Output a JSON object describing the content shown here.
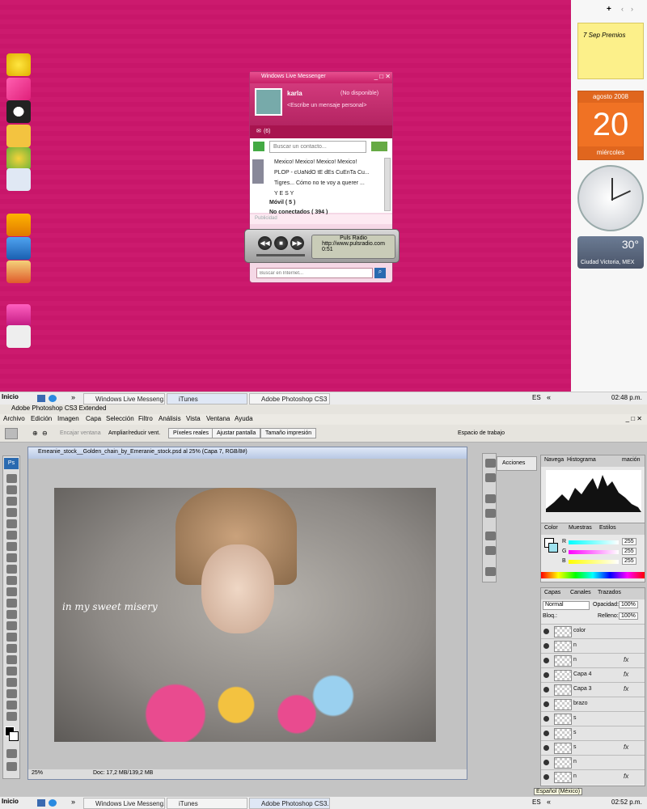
{
  "messenger": {
    "title": "Windows Live Messenger",
    "user_name": "karla",
    "status": "(No disponible)",
    "personal_msg": "<Escribe un mensaje personal>",
    "mail_count": "(6)",
    "search_placeholder": "Buscar un contacto...",
    "contacts": [
      "Mexico! Mexico! Mexico! Mexico!",
      "PLOP - cUaNdO tE dEs CuEnTa Cu...",
      "Tigres... Cómo no te voy a querer ...",
      "Y E S Y"
    ],
    "groups": [
      "Móvil ( 5 )",
      "No conectados ( 394 )"
    ],
    "ad_label": "Publicidad",
    "web_search_placeholder": "Buscar en Internet..."
  },
  "puls_radio": {
    "name": "Puls Radio",
    "url": "http://www.pulsradio.com",
    "time": "0:51"
  },
  "gadgets": {
    "note": "7 Sep Premios",
    "calendar_month": "agosto 2008",
    "calendar_day": "20",
    "calendar_weekday": "miércoles",
    "weather_temp": "30°",
    "weather_city": "Ciudad Victoria, MEX",
    "sidebar_controls": [
      "+",
      "‹",
      "›"
    ]
  },
  "taskbar_top": {
    "start": "Inicio",
    "items": [
      "Windows Live Messeng...",
      "iTunes",
      "Adobe Photoshop CS3 ..."
    ],
    "lang": "ES",
    "clock": "02:48 p.m."
  },
  "photoshop": {
    "title": "Adobe Photoshop CS3 Extended",
    "menu": [
      "Archivo",
      "Edición",
      "Imagen",
      "Capa",
      "Selección",
      "Filtro",
      "Análisis",
      "Vista",
      "Ventana",
      "Ayuda"
    ],
    "options": {
      "fit_window": "Encajar ventana",
      "resize": "Ampliar/reducir vent.",
      "actual_pixels": "Píxeles reales",
      "fit_screen": "Ajustar pantalla",
      "print_size": "Tamaño impresión",
      "workspace": "Espacio de trabajo"
    },
    "doc_title": "Emeanie_stock__Golden_chain_by_Emeranie_stock.psd al 25% (Capa 7, RGB/8#)",
    "zoom": "25%",
    "doc_info": "Doc: 17,2 MB/139,2 MB",
    "artwork_text": "in my sweet misery",
    "panels": {
      "actions_label": "Acciones",
      "nav_tabs": [
        "Navega",
        "Histograma",
        "mación"
      ],
      "color_tabs": [
        "Color",
        "Muestras",
        "Estilos"
      ],
      "color_values": [
        {
          "ch": "R",
          "val": "255"
        },
        {
          "ch": "G",
          "val": "255"
        },
        {
          "ch": "B",
          "val": "255"
        }
      ],
      "layer_tabs": [
        "Capas",
        "Canales",
        "Trazados"
      ],
      "blend_mode": "Normal",
      "opacity_label": "Opacidad:",
      "opacity": "100%",
      "lock_label": "Bloq.:",
      "fill_label": "Relleno:",
      "fill": "100%",
      "layers": [
        {
          "name": "color",
          "fx": ""
        },
        {
          "name": "n",
          "fx": ""
        },
        {
          "name": "n",
          "fx": "fx"
        },
        {
          "name": "Capa 4",
          "fx": "fx"
        },
        {
          "name": "Capa 3",
          "fx": "fx"
        },
        {
          "name": "brazo",
          "fx": ""
        },
        {
          "name": "s",
          "fx": ""
        },
        {
          "name": "s",
          "fx": ""
        },
        {
          "name": "s",
          "fx": "fx"
        },
        {
          "name": "n",
          "fx": ""
        },
        {
          "name": "n",
          "fx": "fx"
        }
      ],
      "layer_tooltip": "Español (México)"
    }
  },
  "taskbar_bottom": {
    "start": "Inicio",
    "items": [
      "Windows Live Messeng...",
      "iTunes",
      "Adobe Photoshop CS3..."
    ],
    "lang": "ES",
    "clock": "02:52 p.m."
  }
}
